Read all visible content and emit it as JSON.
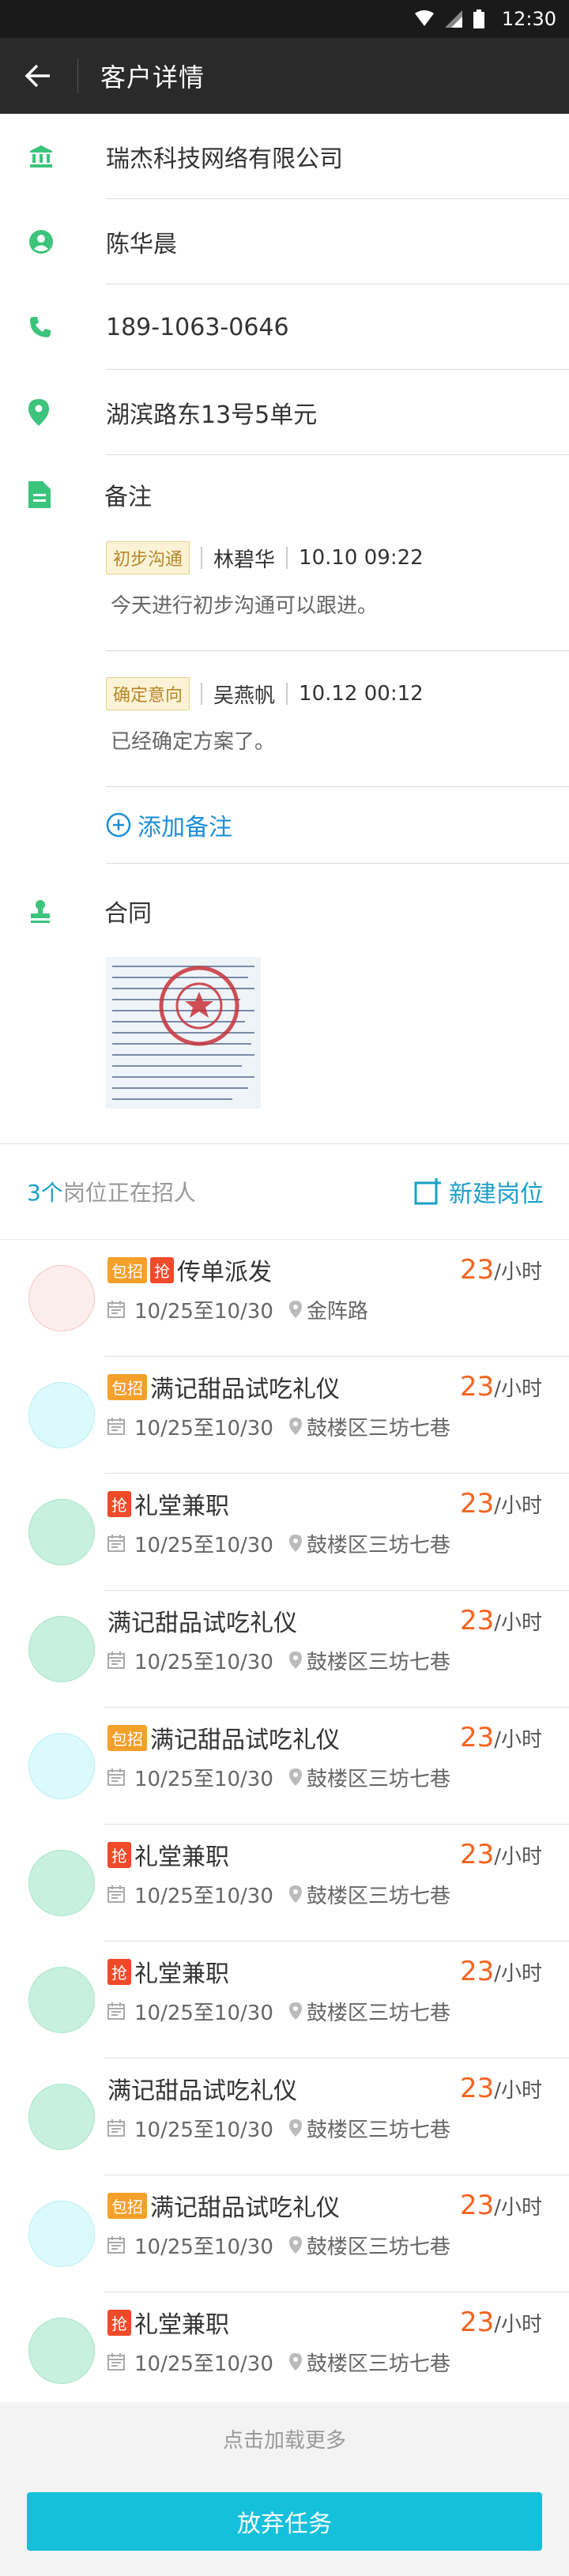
{
  "status_bar": {
    "time": "12:30"
  },
  "header": {
    "title": "客户详情"
  },
  "customer": {
    "company": "瑞杰科技网络有限公司",
    "contact": "陈华晨",
    "phone": "189-1063-0646",
    "address": "湖滨路东13号5单元"
  },
  "notes_section": {
    "label": "备注",
    "notes": [
      {
        "tag": "初步沟通",
        "author": "林碧华",
        "time": "10.10 09:22",
        "content": "今天进行初步沟通可以跟进。"
      },
      {
        "tag": "确定意向",
        "author": "吴燕帆",
        "time": "10.12 00:12",
        "content": "已经确定方案了。"
      }
    ],
    "add_label": "添加备注"
  },
  "contract_section": {
    "label": "合同"
  },
  "jobs_section": {
    "count": "3个",
    "count_suffix": "岗位正在招人",
    "new_label": "新建岗位",
    "unit": "/小时",
    "jobs": [
      {
        "title": "传单派发",
        "badges": [
          "包招",
          "抢"
        ],
        "date": "10/25至10/30",
        "location": "金阵路",
        "price": "23",
        "avatar_color": "#fdeeee",
        "avatar_border": "#f6c4c4"
      },
      {
        "title": "满记甜品试吃礼仪",
        "badges": [
          "包招"
        ],
        "date": "10/25至10/30",
        "location": "鼓楼区三坊七巷",
        "price": "23",
        "avatar_color": "#dcfafc",
        "avatar_border": "#b8eef2"
      },
      {
        "title": "礼堂兼职",
        "badges": [
          "抢"
        ],
        "date": "10/25至10/30",
        "location": "鼓楼区三坊七巷",
        "price": "23",
        "avatar_color": "#c8f0df",
        "avatar_border": "#a8e4cc"
      },
      {
        "title": "满记甜品试吃礼仪",
        "badges": [],
        "date": "10/25至10/30",
        "location": "鼓楼区三坊七巷",
        "price": "23",
        "avatar_color": "#c8f0df",
        "avatar_border": "#a8e4cc"
      },
      {
        "title": "满记甜品试吃礼仪",
        "badges": [
          "包招"
        ],
        "date": "10/25至10/30",
        "location": "鼓楼区三坊七巷",
        "price": "23",
        "avatar_color": "#dcfafc",
        "avatar_border": "#b8eef2"
      },
      {
        "title": "礼堂兼职",
        "badges": [
          "抢"
        ],
        "date": "10/25至10/30",
        "location": "鼓楼区三坊七巷",
        "price": "23",
        "avatar_color": "#c8f0df",
        "avatar_border": "#a8e4cc"
      },
      {
        "title": "礼堂兼职",
        "badges": [
          "抢"
        ],
        "date": "10/25至10/30",
        "location": "鼓楼区三坊七巷",
        "price": "23",
        "avatar_color": "#c8f0df",
        "avatar_border": "#a8e4cc"
      },
      {
        "title": "满记甜品试吃礼仪",
        "badges": [],
        "date": "10/25至10/30",
        "location": "鼓楼区三坊七巷",
        "price": "23",
        "avatar_color": "#c8f0df",
        "avatar_border": "#a8e4cc"
      },
      {
        "title": "满记甜品试吃礼仪",
        "badges": [
          "包招"
        ],
        "date": "10/25至10/30",
        "location": "鼓楼区三坊七巷",
        "price": "23",
        "avatar_color": "#dcfafc",
        "avatar_border": "#b8eef2"
      },
      {
        "title": "礼堂兼职",
        "badges": [
          "抢"
        ],
        "date": "10/25至10/30",
        "location": "鼓楼区三坊七巷",
        "price": "23",
        "avatar_color": "#c8f0df",
        "avatar_border": "#a8e4cc"
      }
    ]
  },
  "footer": {
    "load_more": "点击加载更多",
    "give_up_button": "放弃任务"
  },
  "colors": {
    "accent": "#19a0c8",
    "icon_green": "#3cc47c",
    "price": "#f26522",
    "button": "#15c0dc"
  }
}
